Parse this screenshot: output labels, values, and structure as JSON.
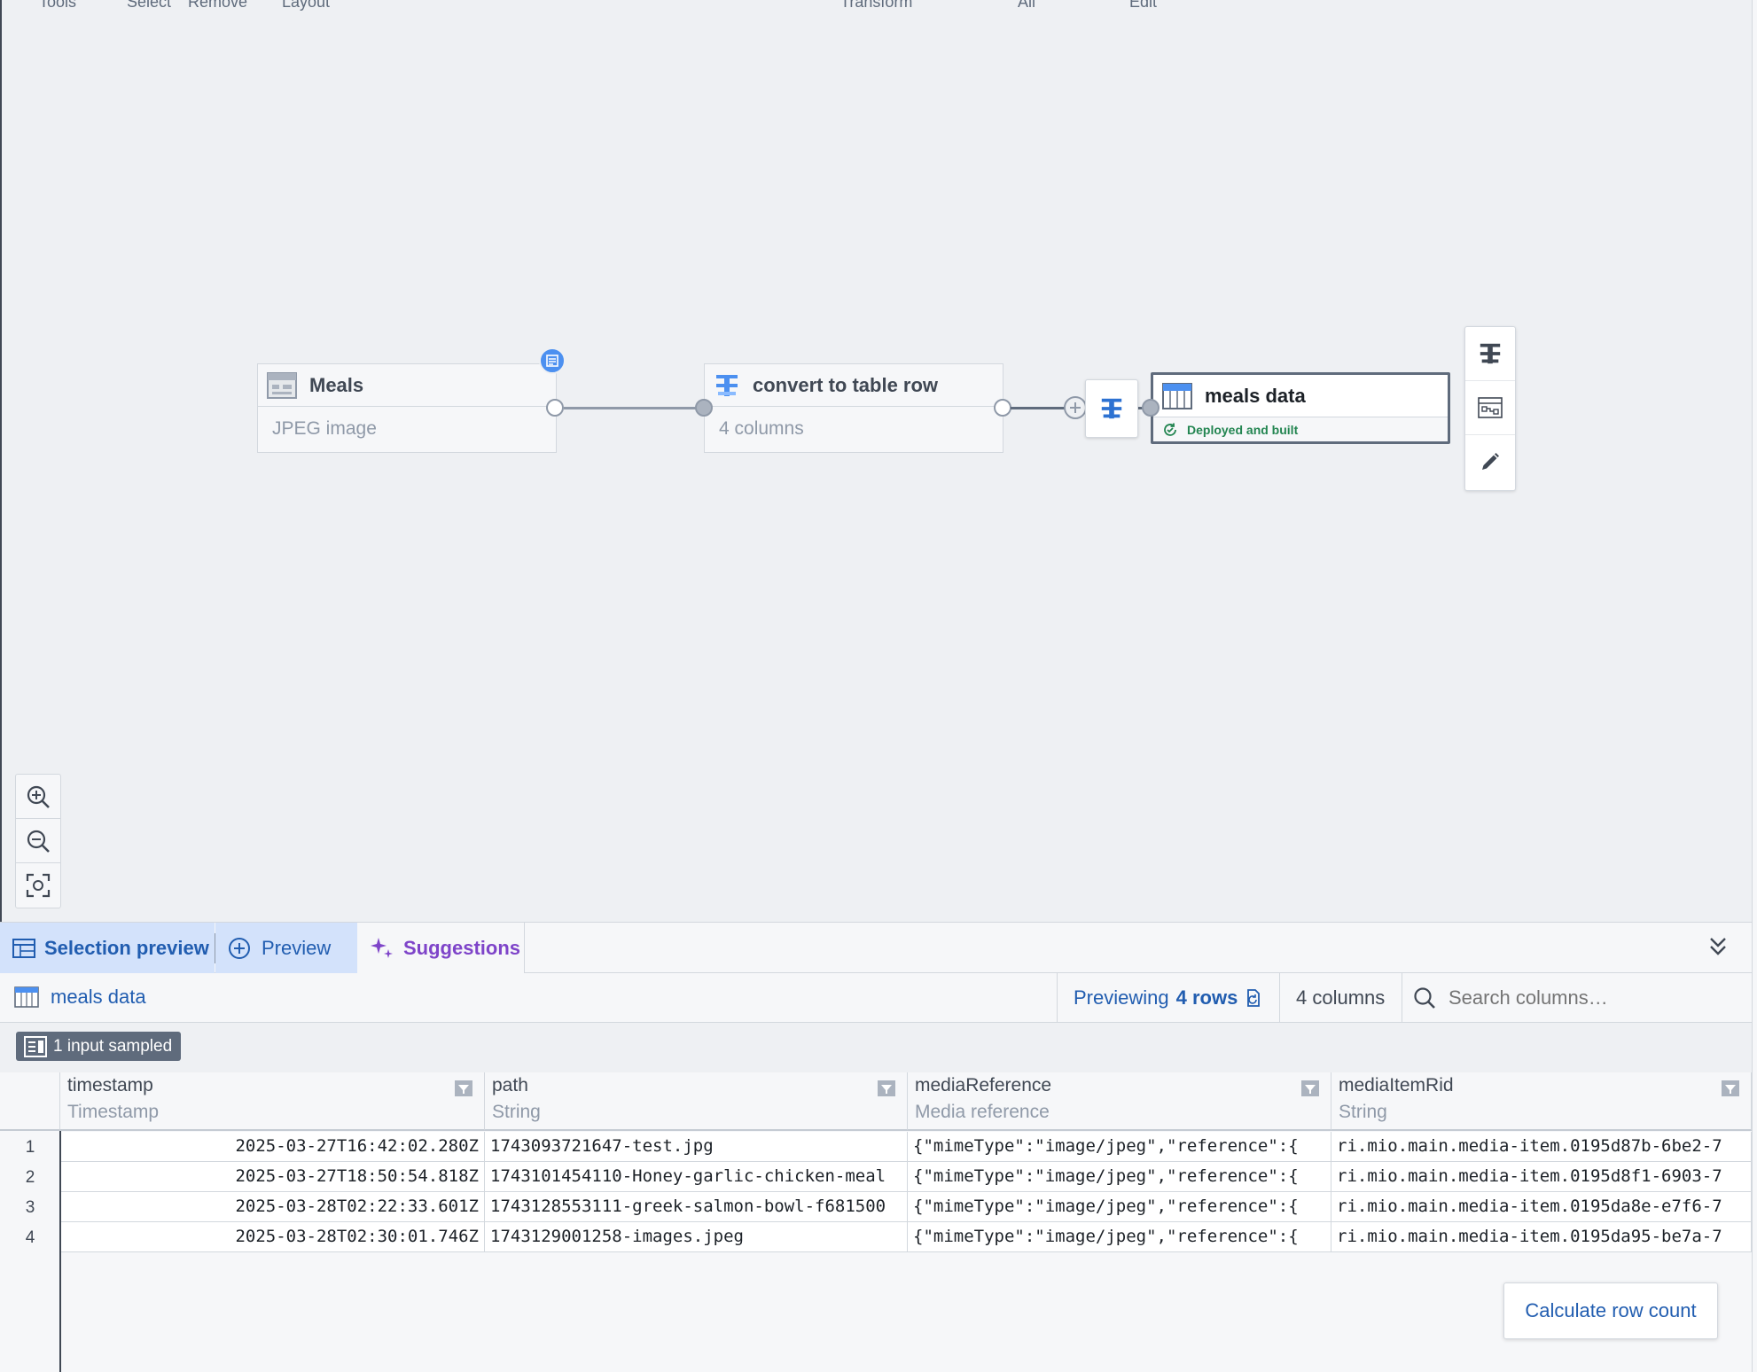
{
  "toolbar_labels": [
    "Tools",
    "Select",
    "Remove",
    "Layout",
    "Transform",
    "All",
    "Edit"
  ],
  "nodes": {
    "meals": {
      "title": "Meals",
      "subtitle": "JPEG image"
    },
    "transform": {
      "title": "convert to table row",
      "subtitle": "4 columns"
    },
    "output": {
      "title": "meals data",
      "status": "Deployed and built"
    }
  },
  "bottom_tabs": {
    "selection_preview": "Selection preview",
    "preview": "Preview",
    "suggestions": "Suggestions"
  },
  "info_bar": {
    "dataset_name": "meals data",
    "previewing_prefix": "Previewing",
    "rows_label": "4 rows",
    "columns_label": "4 columns",
    "search_placeholder": "Search columns…"
  },
  "sample_badge": "1 input sampled",
  "table": {
    "columns": [
      {
        "name": "timestamp",
        "type": "Timestamp"
      },
      {
        "name": "path",
        "type": "String"
      },
      {
        "name": "mediaReference",
        "type": "Media reference"
      },
      {
        "name": "mediaItemRid",
        "type": "String"
      }
    ],
    "rows": [
      {
        "num": "1",
        "timestamp": "2025-03-27T16:42:02.280Z",
        "path": "1743093721647-test.jpg",
        "mediaReference": "{\"mimeType\":\"image/jpeg\",\"reference\":{",
        "mediaItemRid": "ri.mio.main.media-item.0195d87b-6be2-7"
      },
      {
        "num": "2",
        "timestamp": "2025-03-27T18:50:54.818Z",
        "path": "1743101454110-Honey-garlic-chicken-meal",
        "mediaReference": "{\"mimeType\":\"image/jpeg\",\"reference\":{",
        "mediaItemRid": "ri.mio.main.media-item.0195d8f1-6903-7"
      },
      {
        "num": "3",
        "timestamp": "2025-03-28T02:22:33.601Z",
        "path": "1743128553111-greek-salmon-bowl-f681500",
        "mediaReference": "{\"mimeType\":\"image/jpeg\",\"reference\":{",
        "mediaItemRid": "ri.mio.main.media-item.0195da8e-e7f6-7"
      },
      {
        "num": "4",
        "timestamp": "2025-03-28T02:30:01.746Z",
        "path": "1743129001258-images.jpeg",
        "mediaReference": "{\"mimeType\":\"image/jpeg\",\"reference\":{",
        "mediaItemRid": "ri.mio.main.media-item.0195da95-be7a-7"
      }
    ]
  },
  "calc_button": "Calculate row count",
  "colors": {
    "canvas_bg": "#eef0f3",
    "accent_blue": "#215db0",
    "selected_tab_bg": "#d3e2fb",
    "suggestions_purple": "#7e44c9",
    "success_green": "#238551",
    "badge_gray": "#5f6b7c"
  },
  "icons": {
    "meals_node": "image-table-icon",
    "transform_node": "transform-icon",
    "output_node": "table-icon",
    "status": "refresh-check-icon",
    "zoom_in": "zoom-in-icon",
    "zoom_out": "zoom-out-icon",
    "fit": "fit-screen-icon",
    "collapse": "double-chevron-down-icon"
  }
}
